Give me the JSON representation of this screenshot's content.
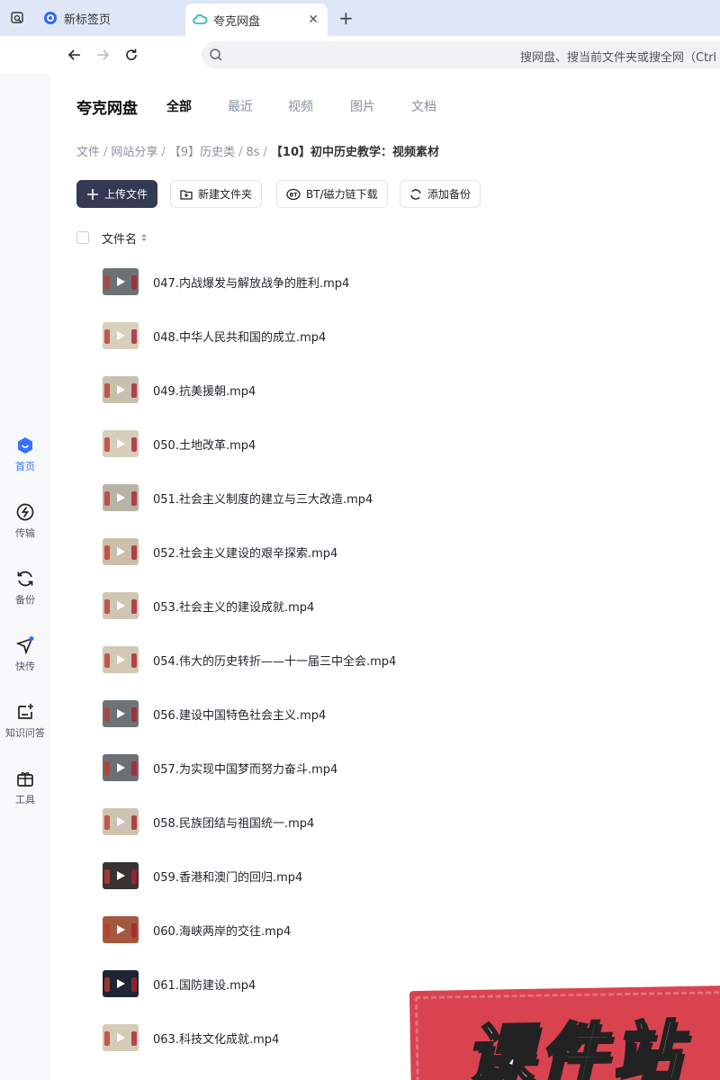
{
  "browser": {
    "tabs": [
      {
        "label": "新标签页"
      },
      {
        "label": "夸克网盘"
      }
    ],
    "omnibox_placeholder": "搜网盘、搜当前文件夹或搜全网（Ctrl +"
  },
  "sidebar": {
    "items": [
      {
        "label": "首页",
        "icon": "home-icon"
      },
      {
        "label": "传输",
        "icon": "transfer-icon"
      },
      {
        "label": "备份",
        "icon": "backup-icon"
      },
      {
        "label": "快传",
        "icon": "quick-send-icon"
      },
      {
        "label": "知识问答",
        "icon": "qa-icon"
      },
      {
        "label": "工具",
        "icon": "tools-icon"
      }
    ]
  },
  "header": {
    "brand": "夸克网盘",
    "tabs": [
      {
        "label": "全部"
      },
      {
        "label": "最近"
      },
      {
        "label": "视频"
      },
      {
        "label": "图片"
      },
      {
        "label": "文档"
      }
    ]
  },
  "breadcrumb": {
    "items": [
      "文件",
      "网站分享",
      "【9】历史类",
      "8s"
    ],
    "current": "【10】初中历史教学：视频素材"
  },
  "toolbar": {
    "upload": "上传文件",
    "new_folder": "新建文件夹",
    "bt": "BT/磁力链下载",
    "backup": "添加备份"
  },
  "list": {
    "header": "文件名",
    "files": [
      {
        "name": "047.内战爆发与解放战争的胜利.mp4"
      },
      {
        "name": "048.中华人民共和国的成立.mp4"
      },
      {
        "name": "049.抗美援朝.mp4"
      },
      {
        "name": "050.土地改革.mp4"
      },
      {
        "name": "051.社会主义制度的建立与三大改造.mp4"
      },
      {
        "name": "052.社会主义建设的艰辛探索.mp4"
      },
      {
        "name": "053.社会主义的建设成就.mp4"
      },
      {
        "name": "054.伟大的历史转折——十一届三中全会.mp4"
      },
      {
        "name": "056.建设中国特色社会主义.mp4"
      },
      {
        "name": "057.为实现中国梦而努力奋斗.mp4"
      },
      {
        "name": "058.民族团结与祖国统一.mp4"
      },
      {
        "name": "059.香港和澳门的回归.mp4"
      },
      {
        "name": "060.海峡两岸的交往.mp4"
      },
      {
        "name": "061.国防建设.mp4"
      },
      {
        "name": "063.科技文化成就.mp4"
      }
    ]
  },
  "watermark": "课件站",
  "colors": {
    "accent": "#3871ff",
    "primary_button": "#343a53",
    "watermark": "#d94350"
  }
}
